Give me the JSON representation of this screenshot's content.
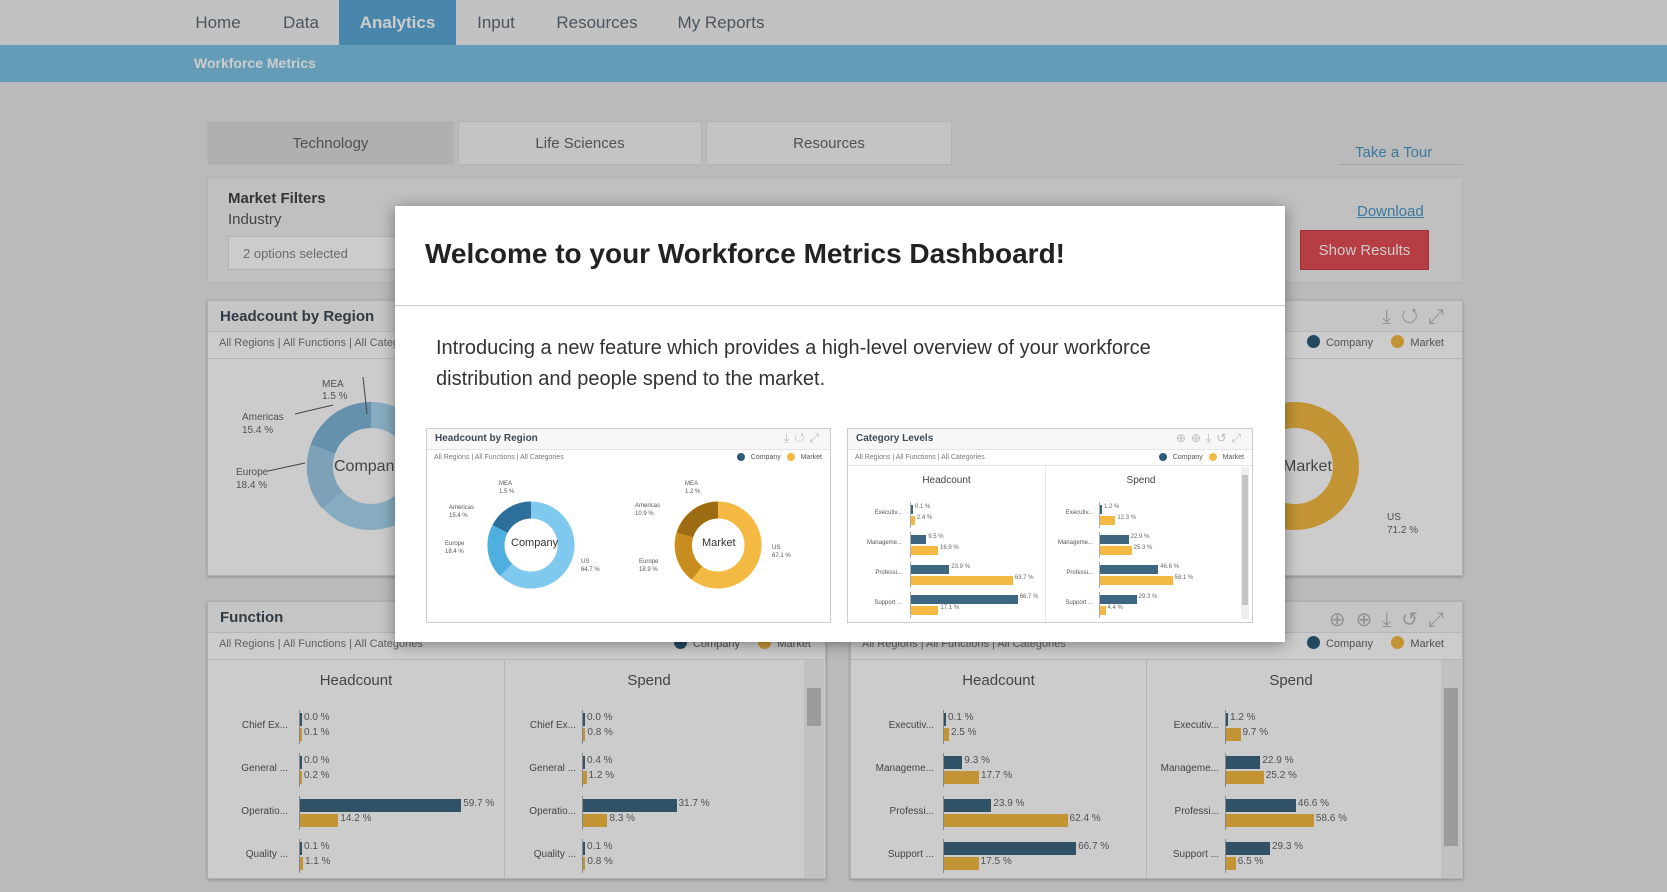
{
  "nav": {
    "tabs": [
      "Home",
      "Data",
      "Analytics",
      "Input",
      "Resources",
      "My Reports"
    ],
    "active": "Analytics"
  },
  "subbar": {
    "title": "Workforce Metrics"
  },
  "industry_tabs": [
    "Technology",
    "Life Sciences",
    "Resources"
  ],
  "take_tour": "Take a Tour",
  "filters": {
    "title": "Market Filters",
    "industry_label": "Industry",
    "industry_value": "2 options selected",
    "download": "Download",
    "show_results": "Show Results"
  },
  "legend": {
    "company": "Company",
    "market": "Market"
  },
  "colors": {
    "company_dark": "#2c5c7a",
    "company_light": "#7fc9ef",
    "market": "#f4b942",
    "bar_company": "#3e6680",
    "bar_market": "#f4b942",
    "accent": "#5aa8d6",
    "button": "#e54d57"
  },
  "panels": {
    "region": {
      "title": "Headcount by Region",
      "filter": "All Regions | All Functions | All Categories",
      "company_label": "Company",
      "market_label": "Market",
      "labels": {
        "mea": "MEA",
        "mea_val": "1.5 %",
        "americas": "Americas",
        "americas_val": "15.4 %",
        "europe": "Europe",
        "europe_val": "18.4 %",
        "us": "US",
        "us_val": "71.2 %"
      }
    },
    "function": {
      "title": "Function",
      "filter": "All Regions | All Functions | All Categories",
      "headcount_label": "Headcount",
      "spend_label": "Spend",
      "headcount_rows": [
        {
          "label": "Chief Ex...",
          "company": "0.0 %",
          "market": "0.1 %"
        },
        {
          "label": "General ...",
          "company": "0.0 %",
          "market": "0.2 %"
        },
        {
          "label": "Operatio...",
          "company": "59.7 %",
          "market": "14.2 %"
        },
        {
          "label": "Quality ...",
          "company": "0.1 %",
          "market": "1.1 %"
        }
      ],
      "spend_rows": [
        {
          "label": "Chief Ex...",
          "company": "0.0 %",
          "market": "0.8 %"
        },
        {
          "label": "General ...",
          "company": "0.4 %",
          "market": "1.2 %"
        },
        {
          "label": "Operatio...",
          "company": "31.7 %",
          "market": "8.3 %"
        },
        {
          "label": "Quality ...",
          "company": "0.1 %",
          "market": "0.8 %"
        }
      ]
    },
    "category": {
      "filter": "All Regions | All Functions | All Categories",
      "headcount_label": "Headcount",
      "spend_label": "Spend",
      "headcount_rows": [
        {
          "label": "Executiv...",
          "company": "0.1 %",
          "market": "2.5 %"
        },
        {
          "label": "Manageme...",
          "company": "9.3 %",
          "market": "17.7 %"
        },
        {
          "label": "Professi...",
          "company": "23.9 %",
          "market": "62.4 %"
        },
        {
          "label": "Support ...",
          "company": "66.7 %",
          "market": "17.5 %"
        }
      ],
      "spend_rows": [
        {
          "label": "Executiv...",
          "company": "1.2 %",
          "market": "9.7 %"
        },
        {
          "label": "Manageme...",
          "company": "22.9 %",
          "market": "25.2 %"
        },
        {
          "label": "Professi...",
          "company": "46.6 %",
          "market": "58.6 %"
        },
        {
          "label": "Support ...",
          "company": "29.3 %",
          "market": "6.5 %"
        }
      ]
    }
  },
  "modal": {
    "title": "Welcome to your Workforce Metrics Dashboard!",
    "text": "Introducing a new feature which provides a high-level overview of your workforce distribution and people spend to the market.",
    "thumb1": {
      "title": "Headcount by Region",
      "filter": "All Regions | All Functions | All Categories",
      "company_center": "Company",
      "market_center": "Market",
      "company_labels": [
        "MEA",
        "1.5 %",
        "Americas",
        "15.4 %",
        "Europe",
        "18.4 %",
        "US",
        "64.7 %"
      ],
      "market_labels": [
        "MEA",
        "1.2 %",
        "Americas",
        "10.9 %",
        "Europe",
        "18.9 %",
        "US",
        "67.1 %"
      ]
    },
    "thumb2": {
      "title": "Category Levels",
      "filter": "All Regions | All Functions | All Categories",
      "headcount_label": "Headcount",
      "spend_label": "Spend",
      "headcount_rows": [
        {
          "label": "Executiv...",
          "company": "0.1 %",
          "market": "2.4 %"
        },
        {
          "label": "Manageme...",
          "company": "9.5 %",
          "market": "16.9 %"
        },
        {
          "label": "Professi...",
          "company": "23.9 %",
          "market": "63.7 %"
        },
        {
          "label": "Support ...",
          "company": "66.7 %",
          "market": "17.1 %"
        }
      ],
      "spend_rows": [
        {
          "label": "Executiv...",
          "company": "1.2 %",
          "market": "12.3 %"
        },
        {
          "label": "Manageme...",
          "company": "22.9 %",
          "market": "25.3 %"
        },
        {
          "label": "Professi...",
          "company": "46.6 %",
          "market": "58.1 %"
        },
        {
          "label": "Support ...",
          "company": "29.3 %",
          "market": "4.4 %"
        }
      ]
    }
  }
}
